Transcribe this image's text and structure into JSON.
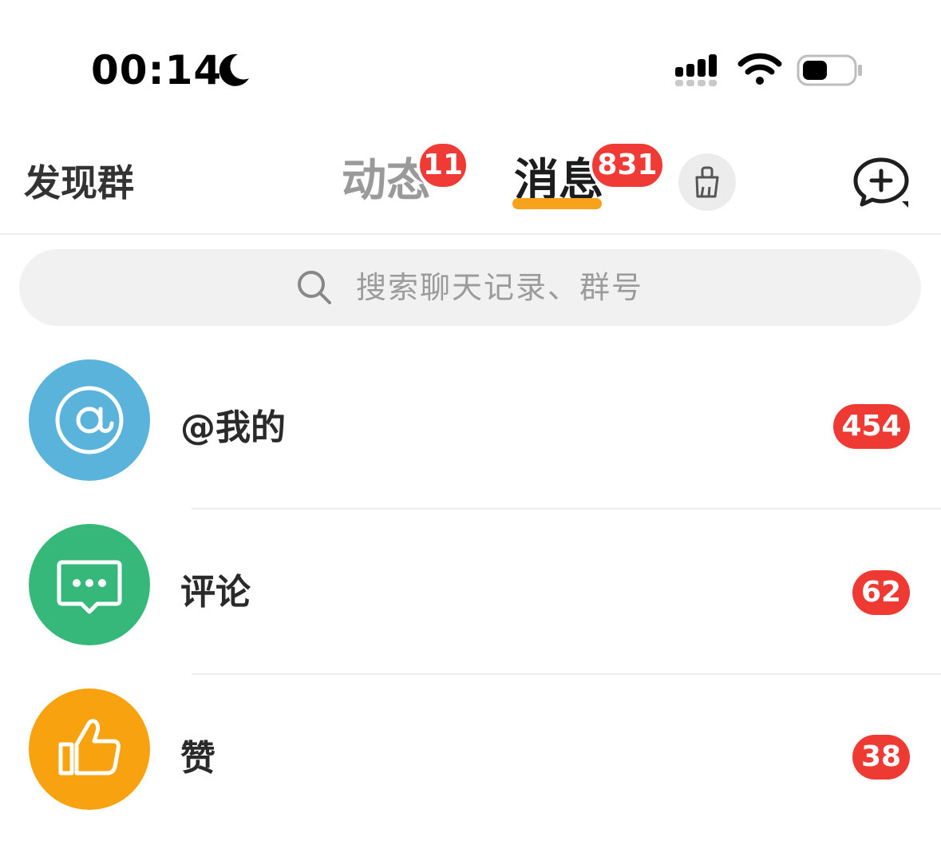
{
  "status_bar": {
    "time": "00:14",
    "icons": [
      "moon-icon",
      "cellular-signal-icon",
      "wifi-icon",
      "battery-icon"
    ]
  },
  "header": {
    "left_label": "发现群",
    "tabs": [
      {
        "label": "动态",
        "badge": "11",
        "active": false
      },
      {
        "label": "消息",
        "badge": "831",
        "active": true
      }
    ],
    "clean_icon": "broom-icon",
    "add_icon": "add-chat-icon",
    "accent_color": "#f7a21b"
  },
  "search": {
    "placeholder": "搜索聊天记录、群号"
  },
  "notifications": [
    {
      "label": "@我的",
      "count": "454",
      "icon": "at-icon",
      "color": "#5ab3da"
    },
    {
      "label": "评论",
      "count": "62",
      "icon": "comment-icon",
      "color": "#36b87a"
    },
    {
      "label": "赞",
      "count": "38",
      "icon": "thumbs-up-icon",
      "color": "#f9a20f"
    }
  ],
  "badge_color": "#ef3a33"
}
